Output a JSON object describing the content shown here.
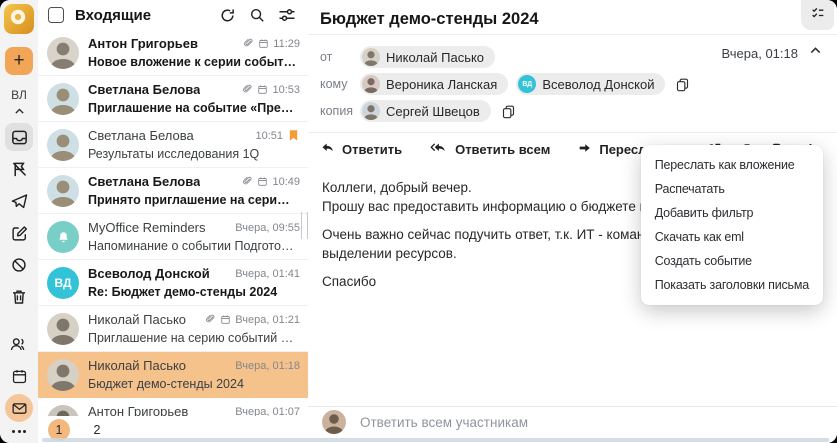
{
  "sidebar": {
    "user_initials": "ВЛ",
    "compose_label": "+",
    "folders": [
      "inbox",
      "flag-removed",
      "sent",
      "drafts",
      "spam",
      "trash"
    ],
    "active_folder": "inbox",
    "apps": [
      "contacts",
      "calendar",
      "mail",
      "more"
    ],
    "active_app": "mail"
  },
  "mail_list": {
    "title": "Входящие",
    "header_icons": [
      "refresh",
      "search",
      "filter"
    ],
    "emails": [
      {
        "sender": "Антон Григорьев",
        "subject": "Новое вложение к серии событий «Аналити...",
        "time": "11:29",
        "unread": true,
        "has_attachment": true,
        "has_calendar": true,
        "flagged": false,
        "selected": false,
        "avatar": {
          "type": "photo",
          "bg": "#d9d3c9",
          "fg": "#877e73"
        }
      },
      {
        "sender": "Светлана Белова",
        "subject": "Приглашение на событие «Предварительно...",
        "time": "10:53",
        "unread": true,
        "has_attachment": true,
        "has_calendar": true,
        "flagged": false,
        "selected": false,
        "avatar": {
          "type": "photo",
          "bg": "#cfdfe6",
          "fg": "#9a8e76"
        }
      },
      {
        "sender": "Светлана Белова",
        "subject": "Результаты исследования 1Q",
        "time": "10:51",
        "unread": false,
        "has_attachment": false,
        "has_calendar": false,
        "flagged": true,
        "selected": false,
        "avatar": {
          "type": "photo",
          "bg": "#cfdfe6",
          "fg": "#9a8e76"
        }
      },
      {
        "sender": "Светлана Белова",
        "subject": "Принято приглашение на серию событий «...",
        "time": "10:49",
        "unread": true,
        "has_attachment": true,
        "has_calendar": true,
        "flagged": false,
        "selected": false,
        "avatar": {
          "type": "photo",
          "bg": "#cfdfe6",
          "fg": "#9a8e76"
        }
      },
      {
        "sender": "MyOffice Reminders",
        "subject": "Напоминание о событии Подготовить отчет...",
        "time": "Вчера, 09:55",
        "unread": false,
        "has_attachment": false,
        "has_calendar": false,
        "flagged": false,
        "selected": false,
        "avatar": {
          "type": "bell",
          "color": "#79CFC7"
        }
      },
      {
        "sender": "Всеволод Донской",
        "subject": "Re: Бюджет демо-стенды 2024",
        "time": "Вчера, 01:41",
        "unread": true,
        "has_attachment": false,
        "has_calendar": false,
        "flagged": false,
        "selected": false,
        "avatar": {
          "type": "initials",
          "text": "ВД",
          "color": "#33C3D8"
        }
      },
      {
        "sender": "Николай Пасько",
        "subject": "Приглашение на серию событий «Демо стен...",
        "time": "Вчера, 01:21",
        "unread": false,
        "has_attachment": true,
        "has_calendar": true,
        "flagged": false,
        "selected": false,
        "avatar": {
          "type": "photo",
          "bg": "#d6d0c5",
          "fg": "#80776c"
        }
      },
      {
        "sender": "Николай Пасько",
        "subject": "Бюджет демо-стенды 2024",
        "time": "Вчера, 01:18",
        "unread": false,
        "has_attachment": false,
        "has_calendar": false,
        "flagged": false,
        "selected": true,
        "avatar": {
          "type": "photo",
          "bg": "#d6d0c5",
          "fg": "#80776c"
        }
      },
      {
        "sender": "Антон Григорьев",
        "subject": "",
        "time": "Вчера, 01:07",
        "unread": false,
        "has_attachment": false,
        "has_calendar": false,
        "flagged": false,
        "selected": false,
        "avatar": {
          "type": "photo",
          "bg": "#c9c4bc",
          "fg": "#6e675e"
        }
      }
    ],
    "pagination": {
      "pages": [
        "1",
        "2"
      ],
      "active": "1"
    }
  },
  "reading_pane": {
    "subject": "Бюджет демо-стенды 2024",
    "timestamp": "Вчера, 01:18",
    "from_label": "от",
    "to_label": "кому",
    "cc_label": "копия",
    "from": [
      {
        "name": "Николай Пасько",
        "avatar": {
          "type": "photo",
          "bg": "#d6d0c5",
          "fg": "#80776c"
        }
      }
    ],
    "to": [
      {
        "name": "Вероника Ланская",
        "avatar": {
          "type": "photo",
          "bg": "#d8c9c2",
          "fg": "#7a6a60"
        }
      },
      {
        "name": "Всеволод Донской",
        "avatar": {
          "type": "initials",
          "text": "ВД",
          "color": "#33C3D8"
        }
      }
    ],
    "cc": [
      {
        "name": "Сергей Швецов",
        "avatar": {
          "type": "photo",
          "bg": "#cdd4da",
          "fg": "#7c7468"
        }
      }
    ],
    "actions": {
      "reply": "Ответить",
      "reply_all": "Ответить всем",
      "forward": "Переслать"
    },
    "toolbar_icons": [
      "open-in-new",
      "delete",
      "tag",
      "more-vertical"
    ],
    "body_paragraphs": [
      [
        "Коллеги, добрый вечер.",
        "Прошу вас предоставить информацию о бюджете на наши демонстраци"
      ],
      [
        "Очень важно сейчас подучить ответ, т.к. ИТ - команда Всеволода, уже",
        "выделении ресурсов."
      ],
      [
        "Спасибо"
      ]
    ],
    "reply_bar": {
      "label": "Ответить всем участникам",
      "avatar": {
        "type": "photo",
        "bg": "#c9b39f",
        "fg": "#6f5d4c"
      }
    }
  },
  "context_menu": {
    "items": [
      "Переслать как вложение",
      "Распечатать",
      "Добавить фильтр",
      "Скачать как eml",
      "Создать событие",
      "Показать заголовки письма"
    ]
  },
  "colors": {
    "accent_orange": "#F2A557",
    "selected_row": "#F6C28C",
    "flag_orange": "#F59B35",
    "cyan_avatar": "#33C3D8",
    "teal_avatar": "#79CFC7"
  }
}
